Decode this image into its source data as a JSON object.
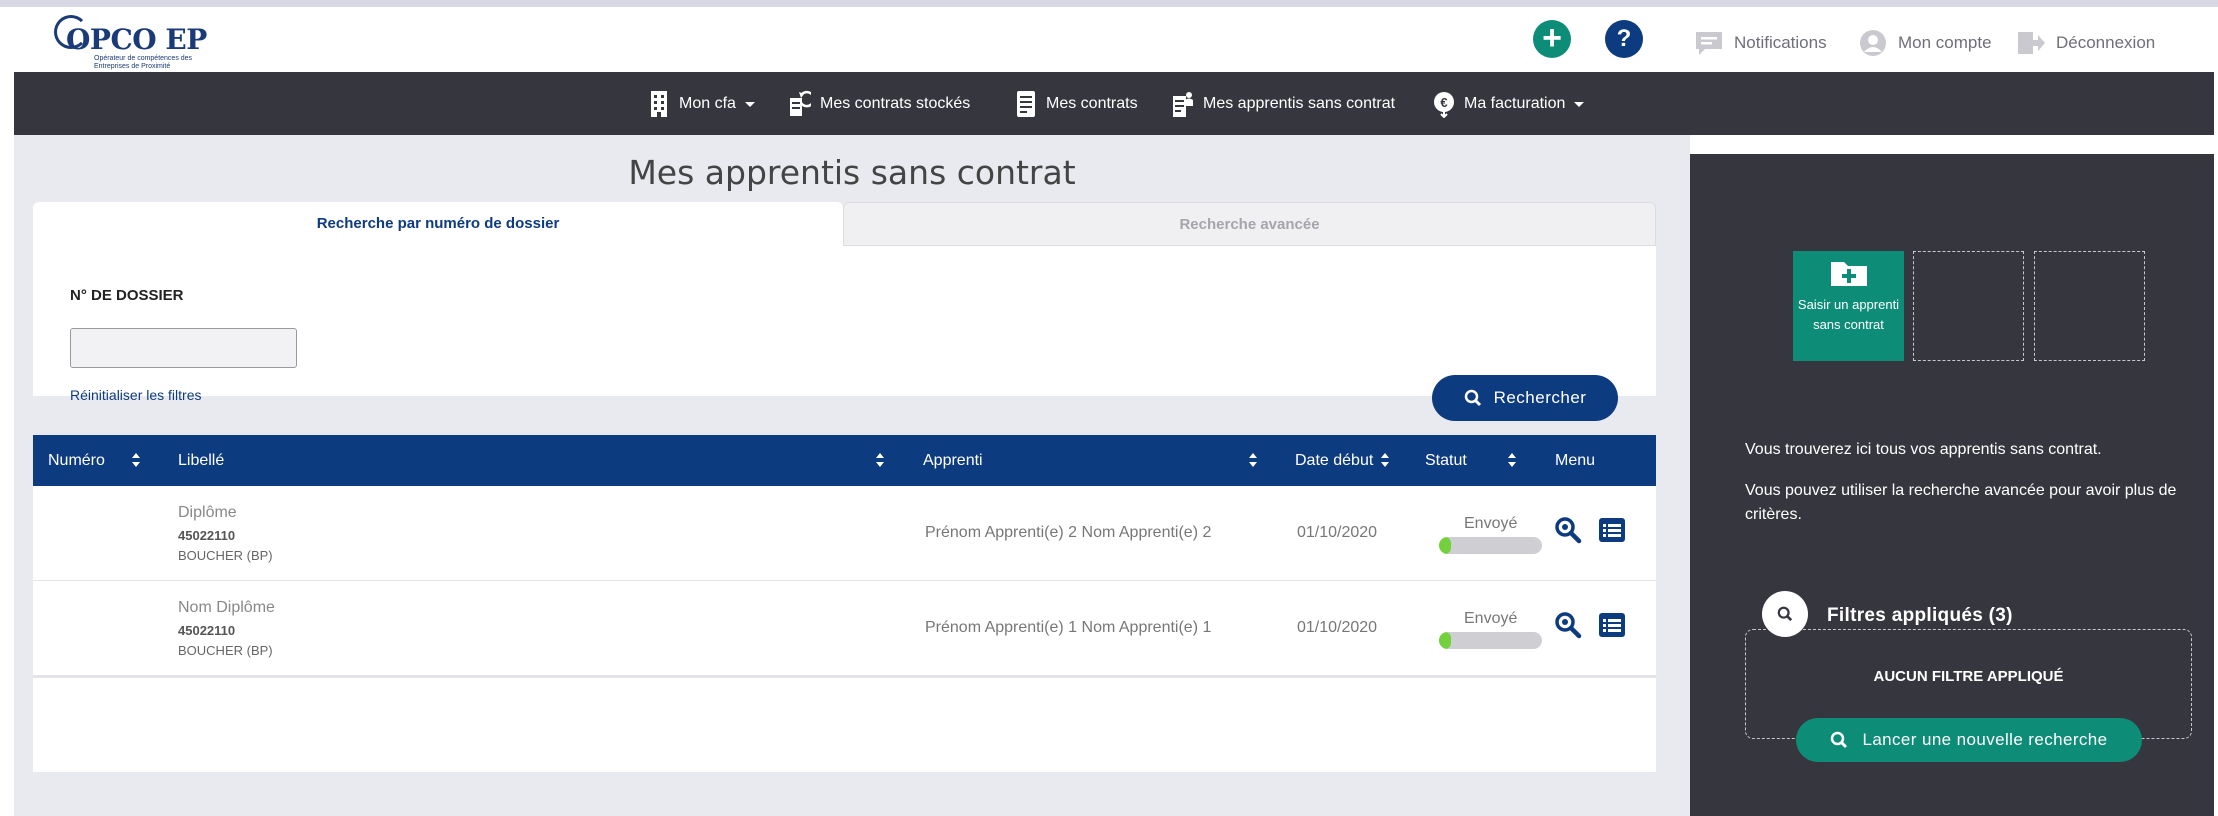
{
  "header": {
    "logo_text": "OPCO EP",
    "logo_subtitle": "Opérateur de compétences des Entreprises de Proximité",
    "add_symbol": "+",
    "help_symbol": "?",
    "notifications_label": "Notifications",
    "account_label": "Mon compte",
    "logout_label": "Déconnexion"
  },
  "nav": {
    "items": [
      {
        "label": "Mon cfa",
        "icon": "building-icon",
        "dropdown": true
      },
      {
        "label": "Mes contrats stockés",
        "icon": "stored-contracts-icon",
        "dropdown": false
      },
      {
        "label": "Mes contrats",
        "icon": "document-icon",
        "dropdown": false
      },
      {
        "label": "Mes apprentis sans contrat",
        "icon": "apprentice-document-icon",
        "dropdown": false
      },
      {
        "label": "Ma facturation",
        "icon": "euro-icon",
        "dropdown": true
      }
    ]
  },
  "page": {
    "title": "Mes apprentis sans contrat",
    "tabs": [
      {
        "label": "Recherche par numéro de dossier",
        "active": true
      },
      {
        "label": "Recherche avancée",
        "active": false
      }
    ],
    "form": {
      "dossier_label": "N° DE DOSSIER",
      "dossier_value": "",
      "reset_label": "Réinitialiser les filtres",
      "search_button": "Rechercher"
    }
  },
  "table": {
    "columns": [
      "Numéro",
      "Libellé",
      "Apprenti",
      "Date début",
      "Statut",
      "Menu"
    ],
    "rows": [
      {
        "numero": "",
        "libelle_title": "Diplôme",
        "libelle_code": "45022110",
        "libelle_sub": "BOUCHER (BP)",
        "apprenti": "Prénom Apprenti(e) 2 Nom Apprenti(e) 2",
        "date_debut": "01/10/2020",
        "statut": "Envoyé",
        "progress": 0.12
      },
      {
        "numero": "",
        "libelle_title": "Nom Diplôme",
        "libelle_code": "45022110",
        "libelle_sub": "BOUCHER (BP)",
        "apprenti": "Prénom Apprenti(e) 1 Nom Apprenti(e) 1",
        "date_debut": "01/10/2020",
        "statut": "Envoyé",
        "progress": 0.12
      }
    ]
  },
  "sidebar": {
    "tile_label": "Saisir un apprenti sans contrat",
    "info_1": "Vous trouverez ici tous vos apprentis sans contrat.",
    "info_2": "Vous pouvez utiliser la recherche avancée pour avoir plus de critères.",
    "filters_title": "Filtres appliqués (3)",
    "no_filter": "AUCUN FILTRE APPLIQUÉ",
    "new_search_button": "Lancer une nouvelle recherche"
  },
  "colors": {
    "primary_blue": "#0d3b7f",
    "teal": "#0d8c77",
    "dark_panel": "#36363f",
    "progress_green": "#73d13d"
  }
}
